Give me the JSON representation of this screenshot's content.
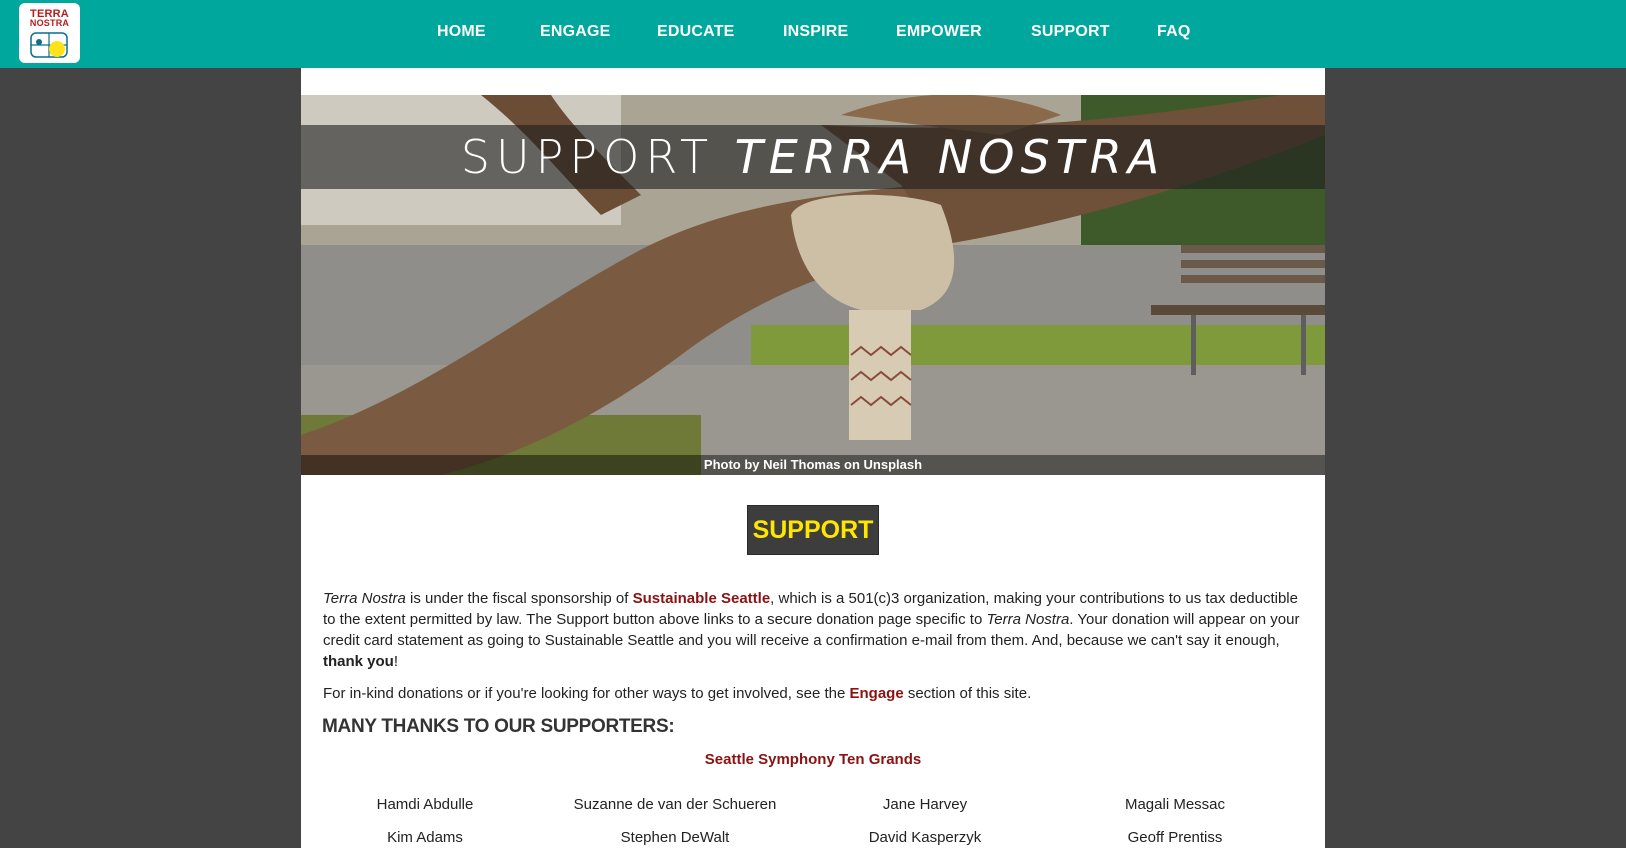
{
  "logo": {
    "line1": "TERRA",
    "line2": "NOSTRA"
  },
  "nav": {
    "items": [
      {
        "label": "HOME"
      },
      {
        "label": "ENGAGE"
      },
      {
        "label": "EDUCATE"
      },
      {
        "label": "INSPIRE"
      },
      {
        "label": "EMPOWER"
      },
      {
        "label": "SUPPORT"
      },
      {
        "label": "FAQ"
      }
    ]
  },
  "hero": {
    "title_plain": "SUPPORT ",
    "title_italic": "TERRA NOSTRA",
    "credit": "Photo by Neil Thomas on Unsplash"
  },
  "support_button": {
    "label": "SUPPORT"
  },
  "intro": {
    "org_italic": "Terra Nostra",
    "t1": " is under the fiscal sponsorship of ",
    "link_sponsor": "Sustainable Seattle",
    "t2": ", which is a 501(c)3 organization, making your contributions to us tax deductible to the extent permitted by law. The Support button above links to a secure donation page specific to ",
    "org_italic2": "Terra Nostra",
    "t3": ". Your donation will appear on your credit card statement as going to Sustainable Seattle and you will receive a confirmation e-mail from them. And, because we can't say it enough, ",
    "bold_thanks": "thank you",
    "t4": "!"
  },
  "inkind": {
    "t1": "For in-kind donations or if you're looking for other ways to get involved, see the ",
    "link_engage": "Engage",
    "t2": " section of this site."
  },
  "supporters": {
    "heading": "MANY THANKS TO OUR SUPPORTERS:",
    "group": "Seattle Symphony Ten Grands",
    "names": [
      [
        "Hamdi Abdulle",
        "Suzanne de van der Schueren",
        "Jane Harvey",
        "Magali Messac"
      ],
      [
        "Kim Adams",
        "Stephen DeWalt",
        "David Kasperzyk",
        "Geoff Prentiss"
      ]
    ]
  },
  "colors": {
    "nav_bg": "#00a79d",
    "page_bg": "#444444",
    "link": "#8b1212",
    "button_text": "#ffe600",
    "button_bg": "#3d3d3d"
  }
}
